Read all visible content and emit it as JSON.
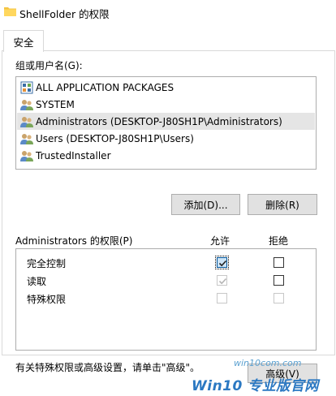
{
  "window": {
    "title": "ShellFolder 的权限"
  },
  "tabs": [
    {
      "label": "安全"
    }
  ],
  "groups_label": "组或用户名(G):",
  "principals": [
    {
      "name": "ALL APPLICATION PACKAGES",
      "icon": "packages-icon",
      "selected": false
    },
    {
      "name": "SYSTEM",
      "icon": "users-icon",
      "selected": false
    },
    {
      "name": "Administrators (DESKTOP-J80SH1P\\Administrators)",
      "icon": "users-icon",
      "selected": true
    },
    {
      "name": "Users (DESKTOP-J80SH1P\\Users)",
      "icon": "users-icon",
      "selected": false
    },
    {
      "name": "TrustedInstaller",
      "icon": "users-icon",
      "selected": false
    }
  ],
  "buttons": {
    "add": "添加(D)...",
    "remove": "删除(R)",
    "advanced": "高级(V)"
  },
  "permissions": {
    "title": "Administrators 的权限(P)",
    "allow_header": "允许",
    "deny_header": "拒绝",
    "rows": [
      {
        "name": "完全控制",
        "allow": true,
        "allow_disabled": false,
        "deny": false,
        "deny_disabled": false
      },
      {
        "name": "读取",
        "allow": true,
        "allow_disabled": true,
        "deny": false,
        "deny_disabled": false
      },
      {
        "name": "特殊权限",
        "allow": false,
        "allow_disabled": true,
        "deny": false,
        "deny_disabled": true
      }
    ]
  },
  "footer_text": "有关特殊权限或高级设置，请单击\"高级\"。",
  "watermark": {
    "site": "win10com.com",
    "brand": "Win10 专业版官网"
  },
  "colors": {
    "selection": "#e5e5e5",
    "button_face": "#e1e1e1",
    "border": "#adadad",
    "folder": "#f4c443"
  }
}
